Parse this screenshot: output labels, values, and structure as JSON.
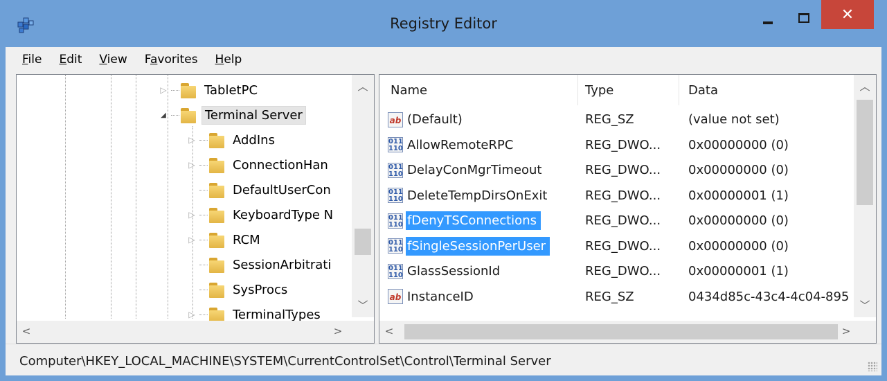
{
  "window": {
    "title": "Registry Editor",
    "close_glyph": "✕"
  },
  "menu": [
    {
      "label": "File",
      "accel": "F",
      "rest": "ile"
    },
    {
      "label": "Edit",
      "accel": "E",
      "rest": "dit"
    },
    {
      "label": "View",
      "accel": "V",
      "rest": "iew"
    },
    {
      "label": "Favorites",
      "pre": "F",
      "accel": "a",
      "rest": "vorites"
    },
    {
      "label": "Help",
      "accel": "H",
      "rest": "elp"
    }
  ],
  "tree": {
    "items": [
      {
        "label": "TabletPC",
        "expander": "collapsed",
        "level": 1
      },
      {
        "label": "Terminal Server",
        "expander": "expanded",
        "level": 1,
        "selected": true
      },
      {
        "label": "AddIns",
        "expander": "collapsed",
        "level": 2
      },
      {
        "label": "ConnectionHan",
        "expander": "collapsed",
        "level": 2
      },
      {
        "label": "DefaultUserCon",
        "expander": "none",
        "level": 2
      },
      {
        "label": "KeyboardType N",
        "expander": "collapsed",
        "level": 2
      },
      {
        "label": "RCM",
        "expander": "collapsed",
        "level": 2
      },
      {
        "label": "SessionArbitrati",
        "expander": "none",
        "level": 2
      },
      {
        "label": "SysProcs",
        "expander": "none",
        "level": 2
      },
      {
        "label": "TerminalTypes",
        "expander": "collapsed",
        "level": 2
      }
    ]
  },
  "list": {
    "columns": {
      "name": "Name",
      "type": "Type",
      "data": "Data"
    },
    "rows": [
      {
        "icon": "string-value-icon",
        "kind": "sz",
        "name": "(Default)",
        "type": "REG_SZ",
        "data": "(value not set)",
        "selected": false
      },
      {
        "icon": "dword-value-icon",
        "kind": "dw",
        "name": "AllowRemoteRPC",
        "type": "REG_DWO...",
        "data": "0x00000000 (0)",
        "selected": false
      },
      {
        "icon": "dword-value-icon",
        "kind": "dw",
        "name": "DelayConMgrTimeout",
        "type": "REG_DWO...",
        "data": "0x00000000 (0)",
        "selected": false
      },
      {
        "icon": "dword-value-icon",
        "kind": "dw",
        "name": "DeleteTempDirsOnExit",
        "type": "REG_DWO...",
        "data": "0x00000001 (1)",
        "selected": false
      },
      {
        "icon": "dword-value-icon",
        "kind": "dw",
        "name": "fDenyTSConnections",
        "type": "REG_DWO...",
        "data": "0x00000000 (0)",
        "selected": true
      },
      {
        "icon": "dword-value-icon",
        "kind": "dw",
        "name": "fSingleSessionPerUser",
        "type": "REG_DWO...",
        "data": "0x00000000 (0)",
        "selected": true
      },
      {
        "icon": "dword-value-icon",
        "kind": "dw",
        "name": "GlassSessionId",
        "type": "REG_DWO...",
        "data": "0x00000001 (1)",
        "selected": false
      },
      {
        "icon": "string-value-icon",
        "kind": "sz",
        "name": "InstanceID",
        "type": "REG_SZ",
        "data": "0434d85c-43c4-4c04-895",
        "selected": false
      }
    ]
  },
  "status": {
    "path": "Computer\\HKEY_LOCAL_MACHINE\\SYSTEM\\CurrentControlSet\\Control\\Terminal Server"
  },
  "colors": {
    "title_bar": "#6ea0d7",
    "close_button": "#c7463a",
    "selection": "#3399ff"
  }
}
